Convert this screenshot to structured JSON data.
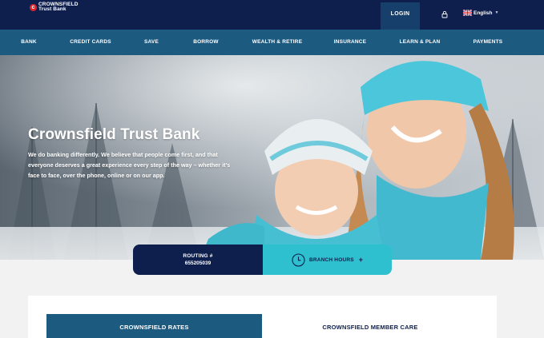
{
  "header": {
    "logo_line1": "CROWNSFIELD",
    "logo_line2": "Trust Bank",
    "login_label": "LOGIN",
    "language": "English",
    "icons": {
      "lock": "lock-icon",
      "flag": "uk-flag-icon",
      "chevron": "chevron-down-icon"
    }
  },
  "nav": {
    "items": [
      {
        "label": "BANK"
      },
      {
        "label": "CREDIT CARDS"
      },
      {
        "label": "SAVE"
      },
      {
        "label": "BORROW"
      },
      {
        "label": "WEALTH & RETIRE"
      },
      {
        "label": "INSURANCE"
      },
      {
        "label": "LEARN & PLAN"
      },
      {
        "label": "PAYMENTS"
      }
    ]
  },
  "hero": {
    "title": "Crownsfield Trust Bank",
    "description": "We do banking differently. We believe that people come first, and that everyone deserves a great experience every step of the way – whether it’s face to face, over the phone, online or on our app."
  },
  "routing": {
    "label": "ROUTING #",
    "number": "655205039"
  },
  "branch_hours": {
    "label": "BRANCH HOURS",
    "icon": "clock-icon",
    "expand": "+"
  },
  "sections": {
    "rates_title": "CROWNSFIELD RATES",
    "member_care_title": "CROWNSFIELD MEMBER CARE"
  },
  "colors": {
    "topbar": "#0e1f4d",
    "nav": "#1d5a80",
    "accent_teal": "#2ec0cf",
    "brand_red": "#e2232a"
  }
}
